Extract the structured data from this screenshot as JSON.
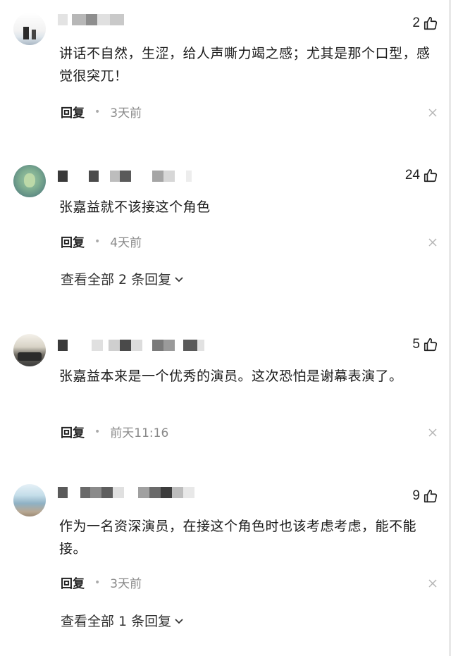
{
  "comments": [
    {
      "likes": "2",
      "text": "讲话不自然，生涩，给人声嘶力竭之感；尤其是那个口型，感觉很突兀！",
      "reply_label": "回复",
      "time": "3天前"
    },
    {
      "likes": "24",
      "text": "张嘉益就不该接这个角色",
      "reply_label": "回复",
      "time": "4天前",
      "more_replies": "查看全部 2 条回复"
    },
    {
      "likes": "5",
      "text": "张嘉益本来是一个优秀的演员。这次恐怕是谢幕表演了。",
      "reply_label": "回复",
      "time": "前天11:16"
    },
    {
      "likes": "9",
      "text": "作为一名资深演员，在接这个角色时也该考虑考虑，能不能接。",
      "reply_label": "回复",
      "time": "3天前",
      "more_replies": "查看全部 1 条回复"
    }
  ],
  "colors": {
    "text": "#1a1a1a",
    "muted": "#8a8a8a",
    "divider_dot": "#aaaaaa"
  },
  "icons": [
    "thumbs-up-icon",
    "close-icon",
    "chevron-down-icon"
  ]
}
